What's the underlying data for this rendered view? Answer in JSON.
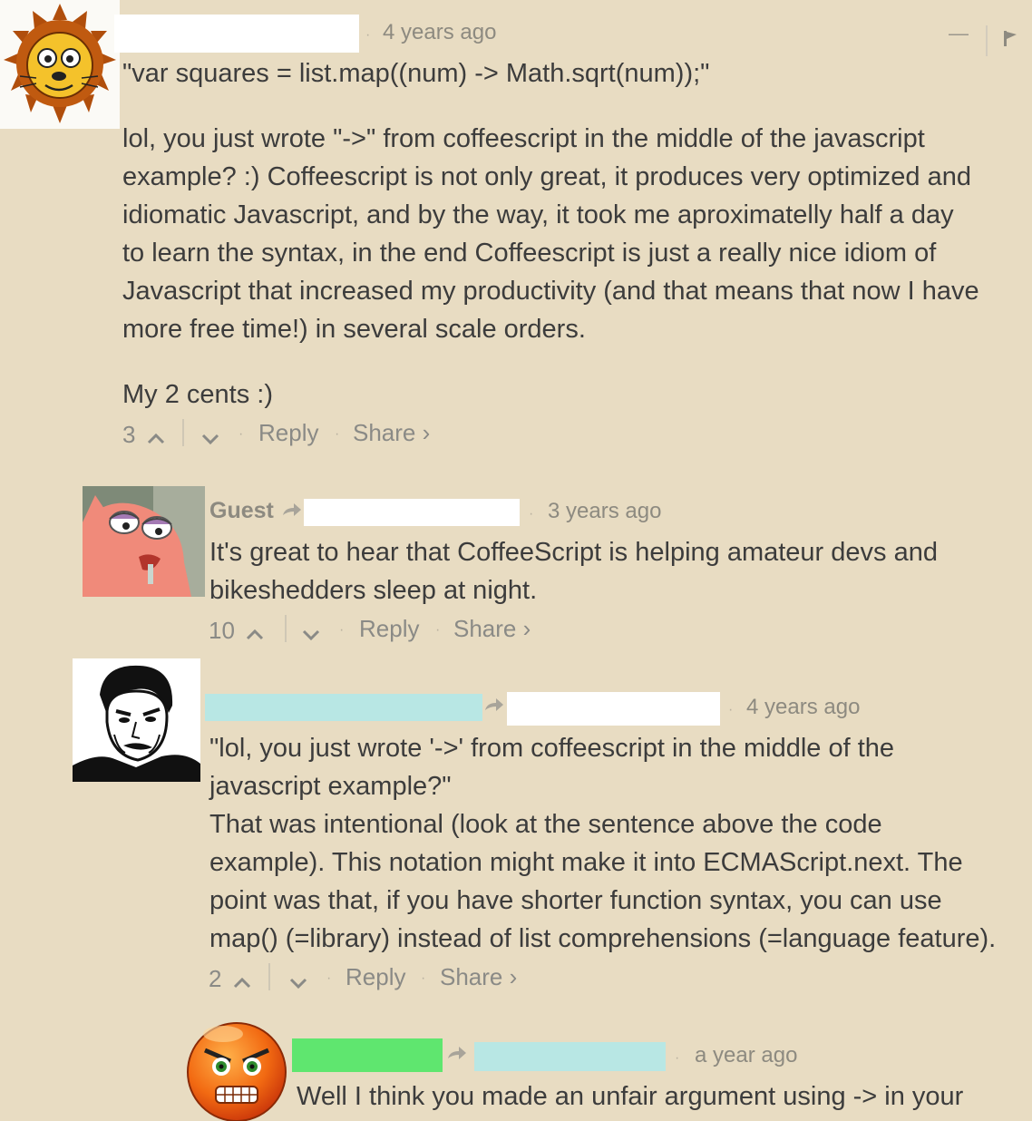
{
  "comments": [
    {
      "time": "4 years ago",
      "quote": "\"var squares = list.map((num) -> Math.sqrt(num));\"",
      "lines": [
        "lol, you just wrote \"->\" from coffeescript in the middle of the javascript",
        "example? :) Coffeescript is not only great, it produces very optimized and",
        "idiomatic Javascript, and by the way, it took me aproximatelly half a day",
        "to learn the syntax, in the end Coffeescript is just a really nice idiom of",
        "Javascript that increased my productivity (and that means that now I have",
        "more free time!) in several scale orders."
      ],
      "closing": "My 2 cents :)",
      "votes": "3",
      "reply": "Reply",
      "share": "Share ›",
      "minimize": "—",
      "flag_icon": "flag-icon"
    },
    {
      "author": "Guest",
      "time": "3 years ago",
      "lines": [
        "It's great to hear that CoffeeScript is helping amateur devs and",
        "bikeshedders sleep at night."
      ],
      "votes": "10",
      "reply": "Reply",
      "share": "Share ›"
    },
    {
      "time": "4 years ago",
      "lines": [
        "\"lol, you just wrote '->' from coffeescript in the middle of the",
        "javascript example?\"",
        "That was intentional (look at the sentence above the code",
        "example). This notation might make it into ECMAScript.next. The",
        "point was that, if you have shorter function syntax, you can use",
        "map() (=library) instead of list comprehensions (=language feature)."
      ],
      "votes": "2",
      "reply": "Reply",
      "share": "Share ›"
    },
    {
      "time": "a year ago",
      "lines": [
        "Well I think you made an unfair argument using -> in your"
      ]
    }
  ],
  "colors": {
    "background": "#e8dcc2",
    "redaction_white": "#ffffff",
    "redaction_cyan": "#b8e7e4",
    "redaction_green": "#5fe66f"
  }
}
